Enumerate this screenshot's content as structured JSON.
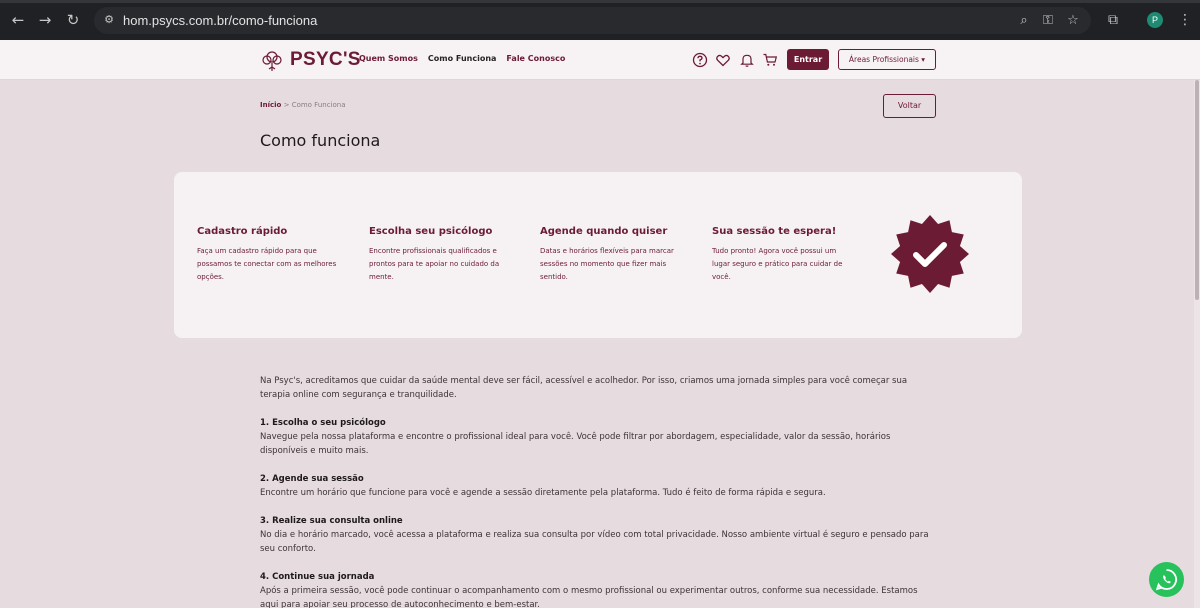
{
  "browser": {
    "url": "hom.psycs.com.br/como-funciona",
    "profile_initial": "P"
  },
  "header": {
    "logo_text": "PSYC'S",
    "menu": [
      {
        "label": "Quem Somos"
      },
      {
        "label": "Como Funciona"
      },
      {
        "label": "Fale Conosco"
      }
    ],
    "login_label": "Entrar",
    "areas_label": "Áreas Profissionais ▾"
  },
  "breadcrumb": {
    "home": "Início",
    "separator": " > ",
    "current": "Como Funciona"
  },
  "back_label": "Voltar",
  "page_title": "Como funciona",
  "steps": [
    {
      "title": "Cadastro rápido",
      "text": "Faça um cadastro rápido para que possamos te conectar com as melhores opções."
    },
    {
      "title": "Escolha seu psicólogo",
      "text": "Encontre profissionais qualificados e prontos para te apoiar no cuidado da mente."
    },
    {
      "title": "Agende quando quiser",
      "text": "Datas e horários flexíveis para marcar sessões no momento que fizer mais sentido."
    },
    {
      "title": "Sua sessão te espera!",
      "text": "Tudo pronto! Agora você possui um lugar seguro e prático para cuidar de você."
    }
  ],
  "article": {
    "intro": "Na Psyc's, acreditamos que cuidar da saúde mental deve ser fácil, acessível e acolhedor. Por isso, criamos uma jornada simples para você começar sua terapia online com segurança e tranquilidade.",
    "sections": [
      {
        "title": "1. Escolha o seu psicólogo",
        "text": "Navegue pela nossa plataforma e encontre o profissional ideal para você. Você pode filtrar por abordagem, especialidade, valor da sessão, horários disponíveis e muito mais."
      },
      {
        "title": "2. Agende sua sessão",
        "text": "Encontre um horário que funcione para você e agende a sessão diretamente pela plataforma. Tudo é feito de forma rápida e segura."
      },
      {
        "title": "3. Realize sua consulta online",
        "text": "No dia e horário marcado, você acessa a plataforma e realiza sua consulta por vídeo com total privacidade. Nosso ambiente virtual é seguro e pensado para seu conforto."
      },
      {
        "title": "4. Continue sua jornada",
        "text": "Após a primeira sessão, você pode continuar o acompanhamento com o mesmo profissional ou experimentar outros, conforme sua necessidade. Estamos aqui para apoiar seu processo de autoconhecimento e bem-estar."
      }
    ]
  },
  "colors": {
    "brand": "#6c1b34",
    "whatsapp": "#27c25b"
  }
}
